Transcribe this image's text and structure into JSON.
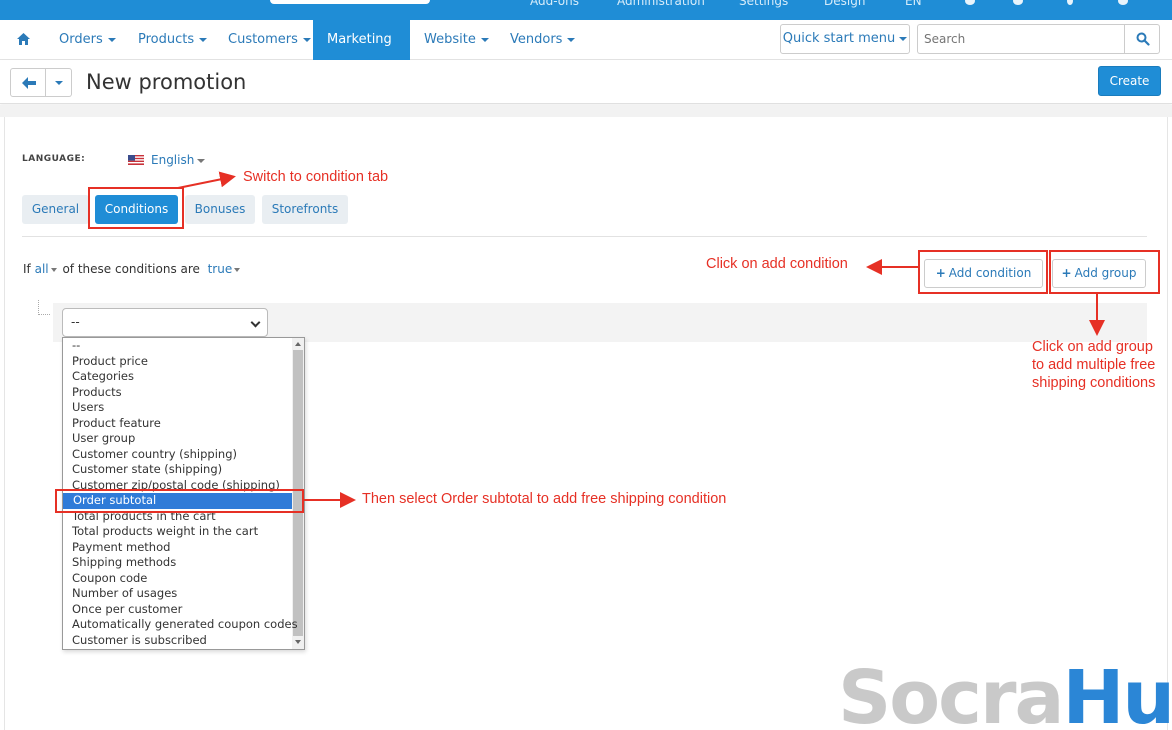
{
  "admin_bar": {
    "items": [
      "Add-ons",
      "Administration",
      "Settings",
      "Design",
      "EN"
    ]
  },
  "nav": {
    "items": [
      {
        "label": "Orders"
      },
      {
        "label": "Products"
      },
      {
        "label": "Customers"
      },
      {
        "label": "Marketing",
        "active": true
      },
      {
        "label": "Website"
      },
      {
        "label": "Vendors"
      }
    ],
    "quick_start": "Quick start menu",
    "search_placeholder": "Search"
  },
  "header": {
    "title": "New promotion",
    "create_label": "Create"
  },
  "language": {
    "label": "LANGUAGE:",
    "value": "English"
  },
  "tabs": [
    "General",
    "Conditions",
    "Bonuses",
    "Storefronts"
  ],
  "conditions": {
    "prefix": "If",
    "mode": "all",
    "middle": "of these conditions are",
    "value": "true",
    "add_condition": "Add condition",
    "add_group": "Add group",
    "select_value": "--"
  },
  "dropdown_options": [
    "--",
    "Product price",
    "Categories",
    "Products",
    "Users",
    "Product feature",
    "User group",
    "Customer country (shipping)",
    "Customer state (shipping)",
    "Customer zip/postal code (shipping)",
    "Order subtotal",
    "Total products in the cart",
    "Total products weight in the cart",
    "Payment method",
    "Shipping methods",
    "Coupon code",
    "Number of usages",
    "Once per customer",
    "Automatically generated coupon codes",
    "Customer is subscribed"
  ],
  "dropdown_selected_index": 10,
  "annotations": {
    "switch_tab": "Switch to condition tab",
    "add_condition": "Click on add condition",
    "add_group_1": "Click on add group",
    "add_group_2": "to add multiple free",
    "add_group_3": "shipping conditions",
    "order_subtotal": "Then select Order subtotal to add free shipping condition"
  },
  "watermark": {
    "part1": "Socra",
    "part2": "Hub"
  },
  "colors": {
    "primary": "#1f8dd6",
    "link": "#2b7ab8",
    "annotation": "#e63025",
    "selected_option": "#2f7bd8"
  }
}
